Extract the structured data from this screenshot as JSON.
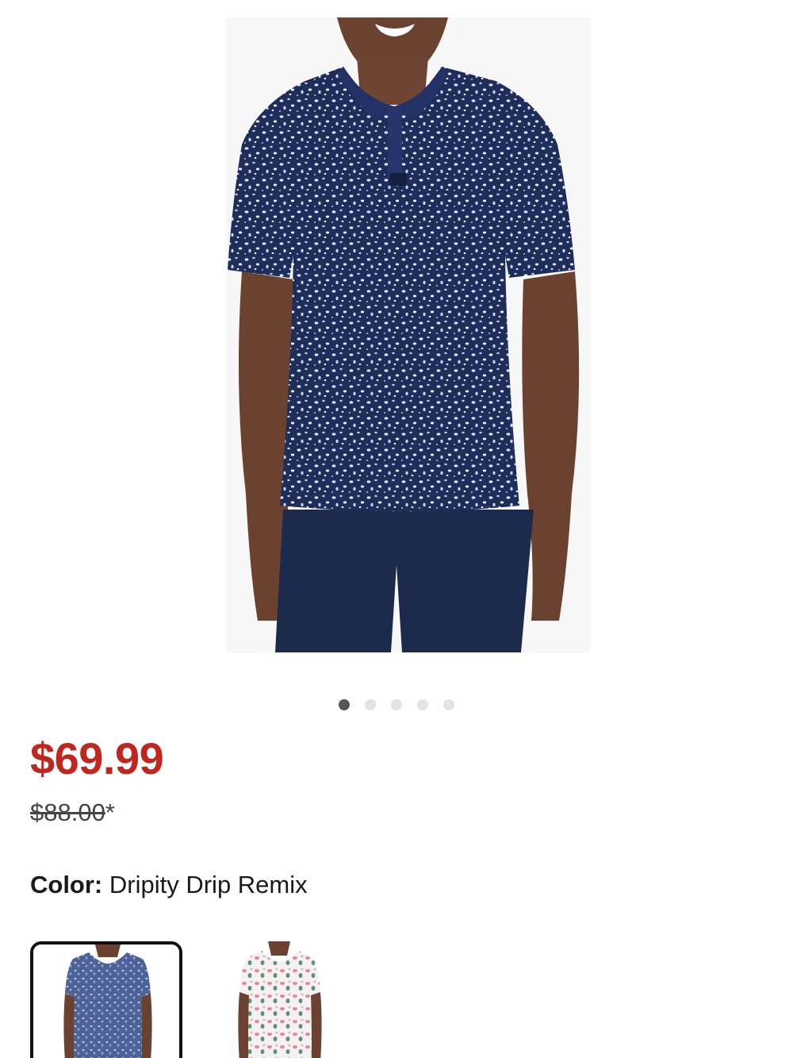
{
  "product": {
    "image_alt": "Men's navy dot-print polo shirt worn by model",
    "carousel": {
      "total": 5,
      "active_index": 0
    },
    "price": {
      "sale": "$69.99",
      "original": "$88.00",
      "original_suffix": "*"
    },
    "color": {
      "label": "Color:",
      "value": "Dripity Drip Remix"
    },
    "swatches": [
      {
        "name": "Dripity Drip Remix",
        "selected": true
      },
      {
        "name": "Pink floral",
        "selected": false
      }
    ]
  },
  "colors": {
    "sale_price": "#c0261d",
    "shirt_navy": "#1f2d5a",
    "shorts_navy": "#1c2a4d",
    "dot_active": "#555555",
    "dot_inactive": "#e3e3e3"
  }
}
